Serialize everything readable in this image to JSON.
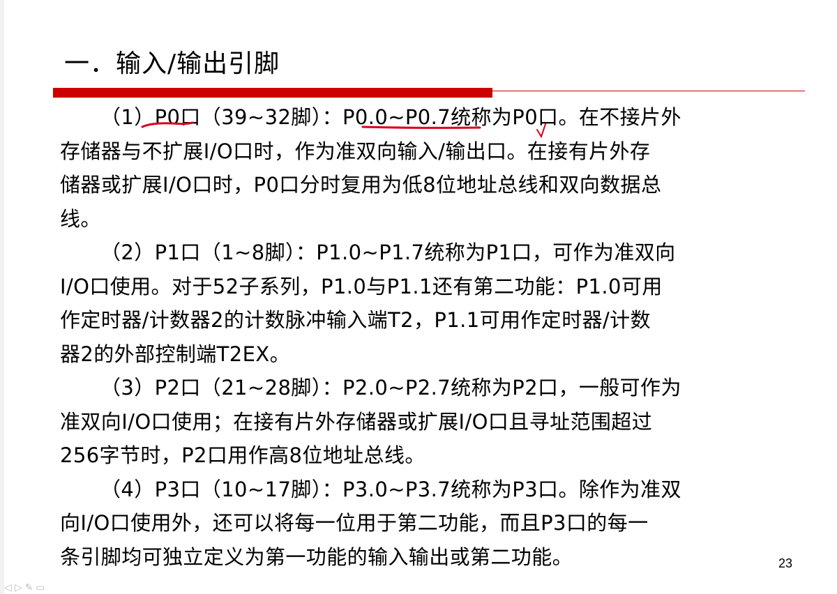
{
  "slide": {
    "title": "一．输入/输出引脚",
    "page_number": "23",
    "accent_color": "#cc0000",
    "annotation_color": "#d9001b"
  },
  "paragraphs": [
    {
      "lines": [
        "（1）P0口（39~32脚）：P0.0~P0.7统称为P0口。在不接片外",
        "存储器与不扩展I/O口时，作为准双向输入/输出口。在接有片外存",
        "储器或扩展I/O口时，P0口分时复用为低8位地址总线和双向数据总",
        "线。"
      ]
    },
    {
      "lines": [
        "（2）P1口（1~8脚）：P1.0~P1.7统称为P1口，可作为准双向",
        "I/O口使用。对于52子系列，P1.0与P1.1还有第二功能：P1.0可用",
        "作定时器/计数器2的计数脉冲输入端T2，P1.1可用作定时器/计数",
        "器2的外部控制端T2EX。"
      ]
    },
    {
      "lines": [
        "（3）P2口（21~28脚）：P2.0~P2.7统称为P2口，一般可作为",
        "准双向I/O口使用；在接有片外存储器或扩展I/O口且寻址范围超过",
        "256字节时，P2口用作高8位地址总线。"
      ]
    },
    {
      "lines": [
        "（4）P3口（10~17脚）：P3.0~P3.7统称为P3口。除作为准双",
        "向I/O口使用外，还可以将每一位用于第二功能，而且P3口的每一",
        "条引脚均可独立定义为第一功能的输入输出或第二功能。"
      ]
    }
  ],
  "toolbar": {
    "icons": [
      "back-icon",
      "forward-icon",
      "pen-icon",
      "menu-icon"
    ]
  }
}
